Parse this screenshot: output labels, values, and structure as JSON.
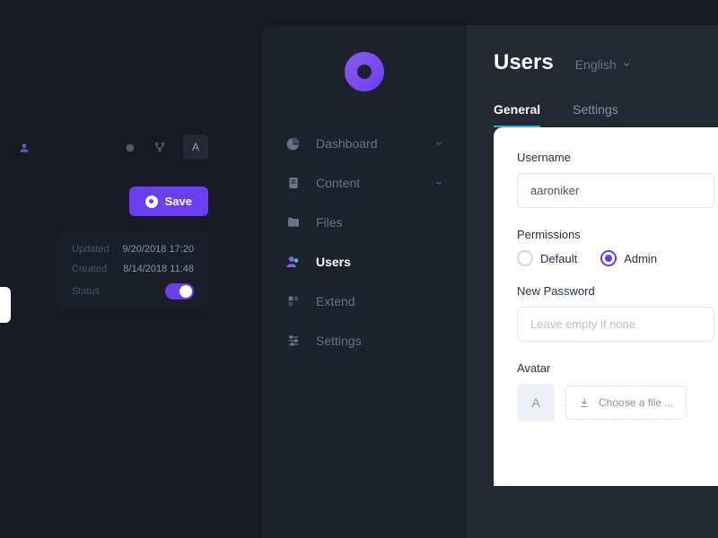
{
  "peek": {
    "avatar_initial": "A",
    "save_label": "Save",
    "meta": {
      "updated_label": "Updated",
      "updated_value": "9/20/2018 17:20",
      "created_label": "Created",
      "created_value": "8/14/2018 11:48",
      "status_label": "Status"
    }
  },
  "sidebar": {
    "items": [
      {
        "label": "Dashboard",
        "icon": "pie",
        "expandable": true
      },
      {
        "label": "Content",
        "icon": "doc",
        "expandable": true
      },
      {
        "label": "Files",
        "icon": "folder"
      },
      {
        "label": "Users",
        "icon": "users",
        "active": true
      },
      {
        "label": "Extend",
        "icon": "extend"
      },
      {
        "label": "Settings",
        "icon": "sliders"
      }
    ]
  },
  "content": {
    "title": "Users",
    "language": "English",
    "tabs": [
      {
        "label": "General",
        "active": true
      },
      {
        "label": "Settings"
      }
    ],
    "form": {
      "username_label": "Username",
      "username_value": "aaroniker",
      "permissions_label": "Permissions",
      "perm_default": "Default",
      "perm_admin": "Admin",
      "password_label": "New Password",
      "password_placeholder": "Leave empty if none",
      "avatar_label": "Avatar",
      "avatar_initial": "A",
      "file_button": "Choose a file ..."
    }
  }
}
